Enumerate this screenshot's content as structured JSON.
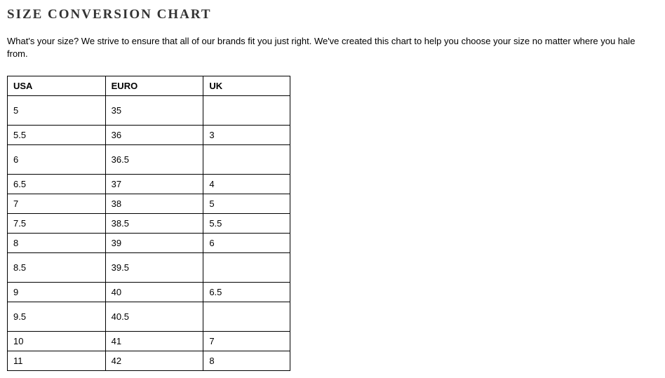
{
  "title": "SIZE CONVERSION CHART",
  "intro": "What's your size? We strive to ensure that all of our brands fit you just right. We've created this chart to help you choose your size no matter where you hale from.",
  "chart_data": {
    "type": "table",
    "headers": {
      "usa": "USA",
      "euro": "EURO",
      "uk": "UK"
    },
    "rows": [
      {
        "usa": "5",
        "euro": "35",
        "uk": "",
        "tall": true
      },
      {
        "usa": "5.5",
        "euro": "36",
        "uk": "3",
        "tall": false
      },
      {
        "usa": "6",
        "euro": "36.5",
        "uk": "",
        "tall": true
      },
      {
        "usa": "6.5",
        "euro": "37",
        "uk": "4",
        "tall": false
      },
      {
        "usa": "7",
        "euro": "38",
        "uk": "5",
        "tall": false
      },
      {
        "usa": "7.5",
        "euro": "38.5",
        "uk": "5.5",
        "tall": false
      },
      {
        "usa": "8",
        "euro": "39",
        "uk": "6",
        "tall": false
      },
      {
        "usa": "8.5",
        "euro": "39.5",
        "uk": "",
        "tall": true
      },
      {
        "usa": "9",
        "euro": "40",
        "uk": "6.5",
        "tall": false
      },
      {
        "usa": "9.5",
        "euro": "40.5",
        "uk": "",
        "tall": true
      },
      {
        "usa": "10",
        "euro": "41",
        "uk": "7",
        "tall": false
      },
      {
        "usa": "11",
        "euro": "42",
        "uk": "8",
        "tall": false
      }
    ]
  }
}
